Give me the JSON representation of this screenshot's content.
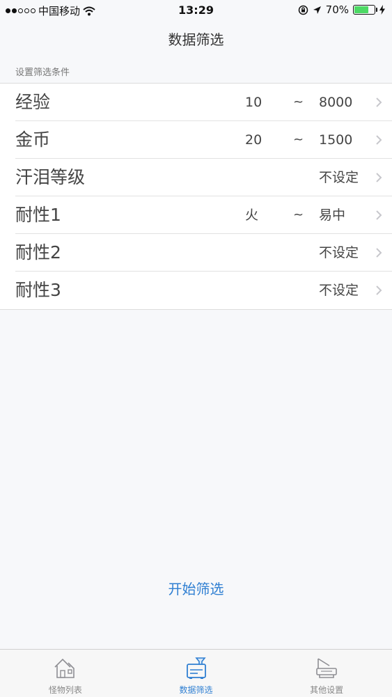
{
  "status_bar": {
    "carrier": "中国移动",
    "time": "13:29",
    "battery_percent": "70%",
    "battery_level": 0.7,
    "signal_filled": 2,
    "signal_total": 5
  },
  "nav": {
    "title": "数据筛选"
  },
  "section_header": "设置筛选条件",
  "filters": [
    {
      "label": "经验",
      "min": "10",
      "tilde": "~",
      "max": "8000"
    },
    {
      "label": "金币",
      "min": "20",
      "tilde": "~",
      "max": "1500"
    },
    {
      "label": "汗泪等级",
      "min": "",
      "tilde": "",
      "max": "不设定"
    },
    {
      "label": "耐性1",
      "min": "火",
      "tilde": "~",
      "max": "易中"
    },
    {
      "label": "耐性2",
      "min": "",
      "tilde": "",
      "max": "不设定"
    },
    {
      "label": "耐性3",
      "min": "",
      "tilde": "",
      "max": "不设定"
    }
  ],
  "start_button": "开始筛选",
  "tabs": [
    {
      "label": "怪物列表",
      "icon": "house-icon",
      "active": false
    },
    {
      "label": "数据筛选",
      "icon": "filter-box-icon",
      "active": true
    },
    {
      "label": "其他设置",
      "icon": "settings-printer-icon",
      "active": false
    }
  ],
  "colors": {
    "accent": "#2f7fd2",
    "battery": "#4cd964",
    "background": "#f7f8fa"
  }
}
